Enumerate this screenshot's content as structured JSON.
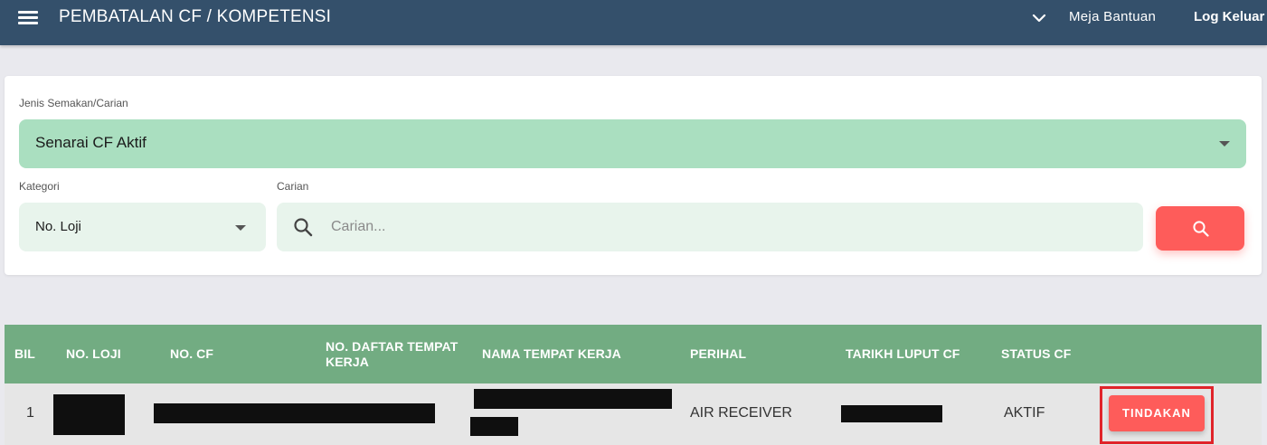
{
  "header": {
    "title": "PEMBATALAN CF / KOMPETENSI",
    "help_label": "Meja Bantuan",
    "logout_label": "Log Keluar"
  },
  "filters": {
    "type_label": "Jenis Semakan/Carian",
    "type_value": "Senarai CF Aktif",
    "category_label": "Kategori",
    "category_value": "No. Loji",
    "search_label": "Carian",
    "search_placeholder": "Carian...",
    "search_value": ""
  },
  "table": {
    "columns": [
      "BIL",
      "NO. LOJI",
      "NO. CF",
      "NO. DAFTAR TEMPAT KERJA",
      "NAMA TEMPAT KERJA",
      "PERIHAL",
      "TARIKH LUPUT CF",
      "STATUS CF"
    ],
    "rows": [
      {
        "bil": "1",
        "no_loji": "[redacted]",
        "no_cf": "[redacted]",
        "no_daftar": "",
        "nama_tempat_kerja": "[redacted]",
        "perihal": "AIR RECEIVER",
        "tarikh_luput": "[redacted]",
        "status": "AKTIF",
        "action_label": "TINDAKAN"
      }
    ]
  },
  "colors": {
    "header_bg": "#34506b",
    "primary_select_bg": "#aadfc0",
    "table_header_bg": "#72ac82",
    "action_red": "#fe5c5a",
    "highlight_border": "#e0242a"
  }
}
